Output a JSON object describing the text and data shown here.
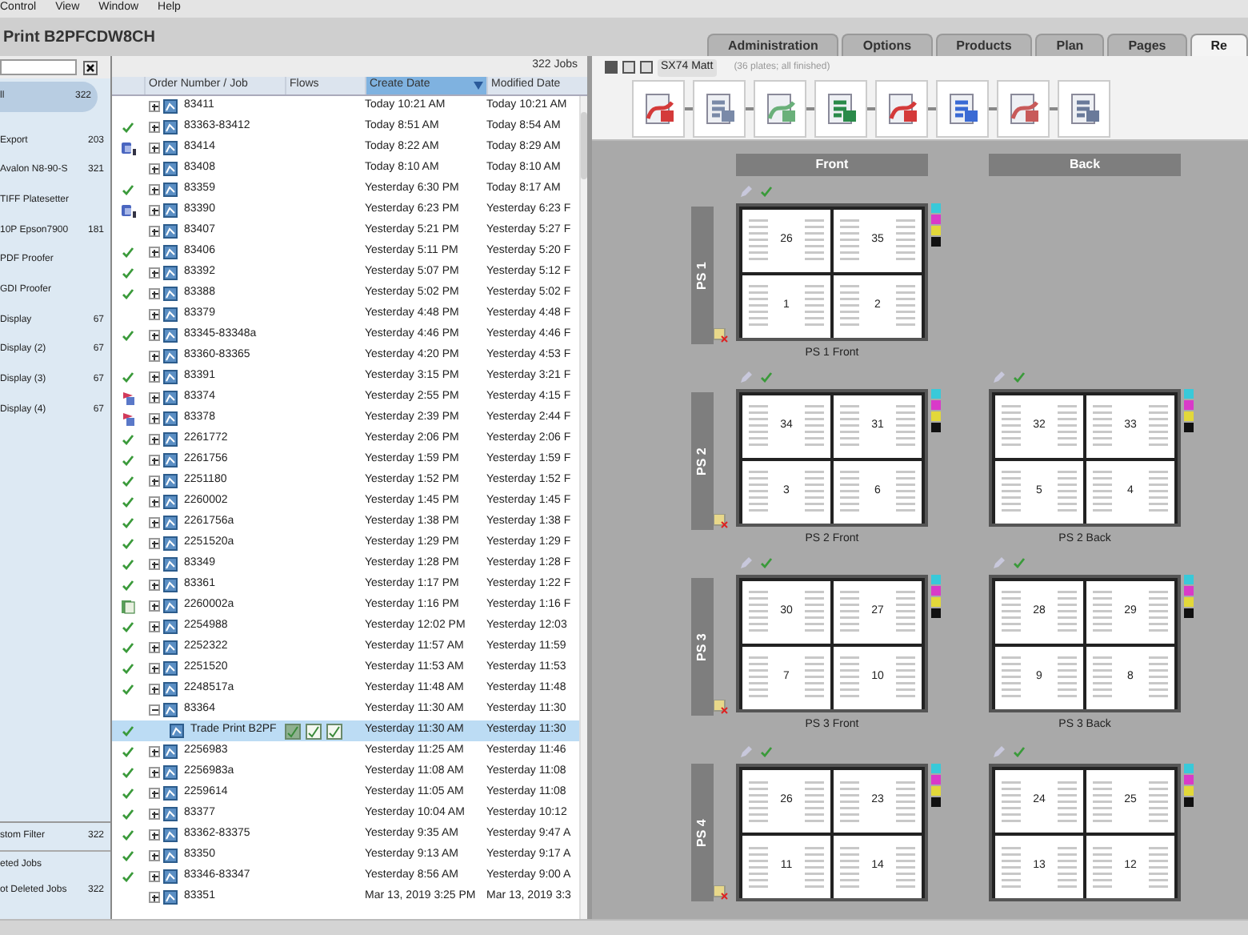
{
  "menu": [
    "Control",
    "View",
    "Window",
    "Help"
  ],
  "title": "Print B2PFCDW8CH",
  "tabs": [
    {
      "label": "Administration",
      "selected": false
    },
    {
      "label": "Options",
      "selected": false
    },
    {
      "label": "Products",
      "selected": false
    },
    {
      "label": "Plan",
      "selected": false
    },
    {
      "label": "Pages",
      "selected": false
    },
    {
      "label": "Re",
      "selected": true
    }
  ],
  "sidebar": {
    "items": [
      {
        "label": "ll",
        "count": "322",
        "selected": true
      },
      {
        "label": "Export",
        "count": "203",
        "selected": false
      },
      {
        "label": "Avalon N8-90-S",
        "count": "321",
        "selected": false
      },
      {
        "label": "TIFF Platesetter",
        "selected": false
      },
      {
        "label": "10P Epson7900",
        "count": "181",
        "selected": false
      },
      {
        "label": "PDF Proofer",
        "selected": false
      },
      {
        "label": "GDI Proofer",
        "selected": false
      },
      {
        "label": "Display",
        "count": "67",
        "selected": false
      },
      {
        "label": "Display (2)",
        "count": "67",
        "selected": false
      },
      {
        "label": "Display (3)",
        "count": "67",
        "selected": false
      },
      {
        "label": "Display (4)",
        "count": "67",
        "selected": false
      }
    ],
    "filters": [
      {
        "label": "stom Filter",
        "count": "322"
      },
      {
        "label": "eted Jobs"
      },
      {
        "label": "ot Deleted Jobs",
        "count": "322"
      }
    ]
  },
  "jobs": {
    "count": "322 Jobs",
    "columns": [
      {
        "label": "Order Number / Job",
        "sorted": false
      },
      {
        "label": "Flows",
        "sorted": false
      },
      {
        "label": "Create Date",
        "sorted": true
      },
      {
        "label": "Modified Date",
        "sorted": false
      }
    ],
    "rows": [
      {
        "order": "83411",
        "expanded": false,
        "selected": false,
        "create": "Today 10:21 AM",
        "modified": "Today 10:21 AM"
      },
      {
        "order": "83363-83412",
        "kind": "check",
        "expanded": false,
        "selected": false,
        "create": "Today 8:51 AM",
        "modified": "Today 8:54 AM"
      },
      {
        "order": "83414",
        "kind": "device",
        "expanded": false,
        "selected": false,
        "create": "Today 8:22 AM",
        "modified": "Today 8:29 AM"
      },
      {
        "order": "83408",
        "expanded": false,
        "selected": false,
        "create": "Today 8:10 AM",
        "modified": "Today 8:10 AM"
      },
      {
        "order": "83359",
        "kind": "check",
        "expanded": false,
        "selected": false,
        "create": "Yesterday 6:30 PM",
        "modified": "Today 8:17 AM"
      },
      {
        "order": "83390",
        "kind": "device",
        "expanded": false,
        "selected": false,
        "create": "Yesterday 6:23 PM",
        "modified": "Yesterday 6:23 F"
      },
      {
        "order": "83407",
        "expanded": false,
        "selected": false,
        "create": "Yesterday 5:21 PM",
        "modified": "Yesterday 5:27 F"
      },
      {
        "order": "83406",
        "kind": "check",
        "expanded": false,
        "selected": false,
        "create": "Yesterday 5:11 PM",
        "modified": "Yesterday 5:20 F"
      },
      {
        "order": "83392",
        "kind": "check",
        "expanded": false,
        "selected": false,
        "create": "Yesterday 5:07 PM",
        "modified": "Yesterday 5:12 F"
      },
      {
        "order": "83388",
        "kind": "check",
        "expanded": false,
        "selected": false,
        "create": "Yesterday 5:02 PM",
        "modified": "Yesterday 5:02 F"
      },
      {
        "order": "83379",
        "expanded": false,
        "selected": false,
        "create": "Yesterday 4:48 PM",
        "modified": "Yesterday 4:48 F"
      },
      {
        "order": "83345-83348a",
        "kind": "check",
        "expanded": false,
        "selected": false,
        "create": "Yesterday 4:46 PM",
        "modified": "Yesterday 4:46 F"
      },
      {
        "order": "83360-83365",
        "expanded": false,
        "selected": false,
        "create": "Yesterday 4:20 PM",
        "modified": "Yesterday 4:53 F"
      },
      {
        "order": "83391",
        "kind": "check",
        "expanded": false,
        "selected": false,
        "create": "Yesterday 3:15 PM",
        "modified": "Yesterday 3:21 F"
      },
      {
        "order": "83374",
        "kind": "alert",
        "expanded": false,
        "selected": false,
        "create": "Yesterday 2:55 PM",
        "modified": "Yesterday 4:15 F"
      },
      {
        "order": "83378",
        "kind": "alert",
        "expanded": false,
        "selected": false,
        "create": "Yesterday 2:39 PM",
        "modified": "Yesterday 2:44 F"
      },
      {
        "order": "2261772",
        "kind": "check",
        "expanded": false,
        "selected": false,
        "create": "Yesterday 2:06 PM",
        "modified": "Yesterday 2:06 F"
      },
      {
        "order": "2261756",
        "kind": "check",
        "expanded": false,
        "selected": false,
        "create": "Yesterday 1:59 PM",
        "modified": "Yesterday 1:59 F"
      },
      {
        "order": "2251180",
        "kind": "check",
        "expanded": false,
        "selected": false,
        "create": "Yesterday 1:52 PM",
        "modified": "Yesterday 1:52 F"
      },
      {
        "order": "2260002",
        "kind": "check",
        "expanded": false,
        "selected": false,
        "create": "Yesterday 1:45 PM",
        "modified": "Yesterday 1:45 F"
      },
      {
        "order": "2261756a",
        "kind": "check",
        "expanded": false,
        "selected": false,
        "create": "Yesterday 1:38 PM",
        "modified": "Yesterday 1:38 F"
      },
      {
        "order": "2251520a",
        "kind": "check",
        "expanded": false,
        "selected": false,
        "create": "Yesterday 1:29 PM",
        "modified": "Yesterday 1:29 F"
      },
      {
        "order": "83349",
        "kind": "check",
        "expanded": false,
        "selected": false,
        "create": "Yesterday 1:28 PM",
        "modified": "Yesterday 1:28 F"
      },
      {
        "order": "83361",
        "kind": "check",
        "expanded": false,
        "selected": false,
        "create": "Yesterday 1:17 PM",
        "modified": "Yesterday 1:22 F"
      },
      {
        "order": "2260002a",
        "kind": "document",
        "expanded": false,
        "selected": false,
        "create": "Yesterday 1:16 PM",
        "modified": "Yesterday 1:16 F"
      },
      {
        "order": "2254988",
        "kind": "check",
        "expanded": false,
        "selected": false,
        "create": "Yesterday 12:02 PM",
        "modified": "Yesterday 12:03"
      },
      {
        "order": "2252322",
        "kind": "check",
        "expanded": false,
        "selected": false,
        "create": "Yesterday 11:57 AM",
        "modified": "Yesterday 11:59"
      },
      {
        "order": "2251520",
        "kind": "check",
        "expanded": false,
        "selected": false,
        "create": "Yesterday 11:53 AM",
        "modified": "Yesterday 11:53"
      },
      {
        "order": "2248517a",
        "kind": "check",
        "expanded": false,
        "selected": false,
        "create": "Yesterday 11:48 AM",
        "modified": "Yesterday 11:48"
      },
      {
        "order": "83364",
        "expanded": true,
        "selected": false,
        "create": "Yesterday 11:30 AM",
        "modified": "Yesterday 11:30",
        "children": [
          {
            "order": "Trade Print B2PF",
            "kind": "check",
            "selected": true,
            "create": "Yesterday 11:30 AM",
            "modified": "Yesterday 11:30"
          }
        ]
      },
      {
        "order": "2256983",
        "kind": "check",
        "expanded": false,
        "selected": false,
        "create": "Yesterday 11:25 AM",
        "modified": "Yesterday 11:46"
      },
      {
        "order": "2256983a",
        "kind": "check",
        "expanded": false,
        "selected": false,
        "create": "Yesterday 11:08 AM",
        "modified": "Yesterday 11:08"
      },
      {
        "order": "2259614",
        "kind": "check",
        "expanded": false,
        "selected": false,
        "create": "Yesterday 11:05 AM",
        "modified": "Yesterday 11:08"
      },
      {
        "order": "83377",
        "kind": "check",
        "expanded": false,
        "selected": false,
        "create": "Yesterday 10:04 AM",
        "modified": "Yesterday 10:12"
      },
      {
        "order": "83362-83375",
        "kind": "check",
        "expanded": false,
        "selected": false,
        "create": "Yesterday 9:35 AM",
        "modified": "Yesterday 9:47 A"
      },
      {
        "order": "83350",
        "kind": "check",
        "expanded": false,
        "selected": false,
        "create": "Yesterday 9:13 AM",
        "modified": "Yesterday 9:17 A"
      },
      {
        "order": "83346-83347",
        "kind": "check",
        "expanded": false,
        "selected": false,
        "create": "Yesterday 8:56 AM",
        "modified": "Yesterday 9:00 A"
      },
      {
        "order": "83351",
        "expanded": false,
        "selected": false,
        "create": "Mar 13, 2019 3:25 PM",
        "modified": "Mar 13, 2019 3:3"
      }
    ]
  },
  "toolbar": {
    "button": "SX74 Matt",
    "status": "(36 plates; all finished)"
  },
  "sides": [
    "Front",
    "Back"
  ],
  "sheets": [
    {
      "label": "PS 1",
      "front": {
        "caption": "PS 1 Front",
        "pages": [
          "26",
          "35",
          "1",
          "2"
        ]
      }
    },
    {
      "label": "PS 2",
      "front": {
        "caption": "PS 2 Front",
        "pages": [
          "34",
          "31",
          "3",
          "6"
        ]
      },
      "back": {
        "caption": "PS 2 Back",
        "pages": [
          "32",
          "33",
          "5",
          "4"
        ]
      }
    },
    {
      "label": "PS 3",
      "front": {
        "caption": "PS 3 Front",
        "pages": [
          "30",
          "27",
          "7",
          "10"
        ]
      },
      "back": {
        "caption": "PS 3 Back",
        "pages": [
          "28",
          "29",
          "9",
          "8"
        ]
      }
    },
    {
      "label": "PS 4",
      "front": {
        "pages": [
          "26",
          "23",
          "11",
          "14"
        ]
      },
      "back": {
        "pages": [
          "24",
          "25",
          "13",
          "12"
        ]
      }
    }
  ]
}
